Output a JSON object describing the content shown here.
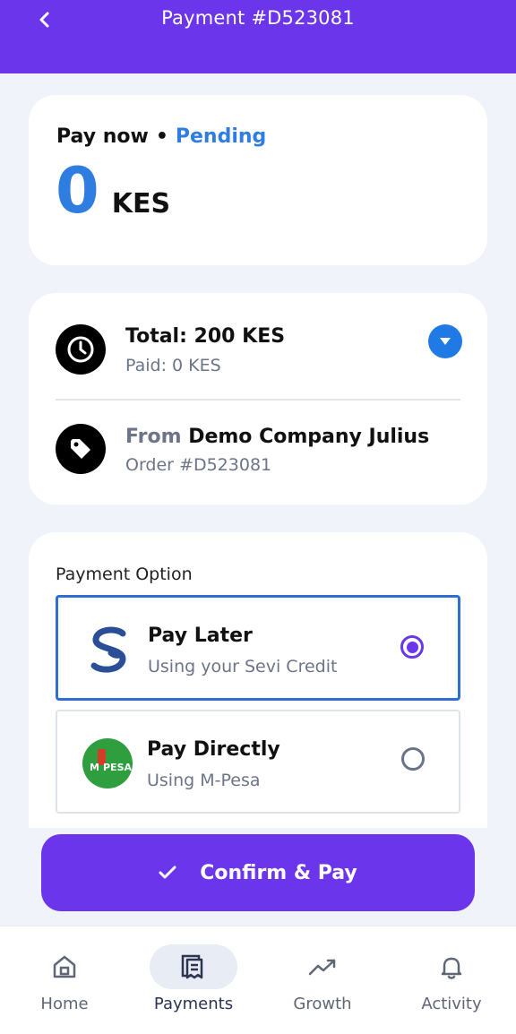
{
  "header": {
    "title": "Payment #D523081",
    "back_icon": "chevron-left-icon"
  },
  "amount_card": {
    "label": "Pay now",
    "separator": "•",
    "status": "Pending",
    "amount": "0",
    "currency": "KES",
    "colors": {
      "accent": "#2f7de1"
    }
  },
  "summary": {
    "total": "Total: 200 KES",
    "paid": "Paid: 0 KES",
    "from_label": "From",
    "from_name": "Demo Company Julius",
    "order": "Order #D523081",
    "icons": [
      "clock-icon",
      "tag-icon",
      "chevron-down-icon"
    ]
  },
  "payment": {
    "heading": "Payment Option",
    "options": [
      {
        "title": "Pay Later",
        "subtitle": "Using your Sevi Credit",
        "selected": true,
        "logo": "sevi-logo"
      },
      {
        "title": "Pay Directly",
        "subtitle": "Using M-Pesa",
        "selected": false,
        "logo": "mpesa-logo",
        "logo_text": "PESA",
        "logo_letter": "M"
      }
    ]
  },
  "confirm": {
    "label": "Confirm & Pay"
  },
  "nav": {
    "items": [
      {
        "label": "Home",
        "icon": "home-icon"
      },
      {
        "label": "Payments",
        "icon": "receipt-icon",
        "active": true
      },
      {
        "label": "Growth",
        "icon": "trend-up-icon"
      },
      {
        "label": "Activity",
        "icon": "bell-icon"
      }
    ]
  },
  "colors": {
    "primary": "#6b35ec",
    "accent_blue": "#2f7de1",
    "background": "#f1f3fb"
  }
}
